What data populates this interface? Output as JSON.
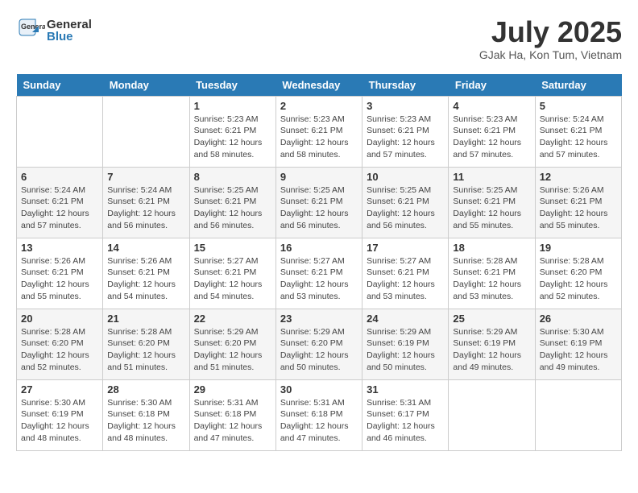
{
  "header": {
    "logo_line1": "General",
    "logo_line2": "Blue",
    "month_title": "July 2025",
    "location": "GJak Ha, Kon Tum, Vietnam"
  },
  "days_of_week": [
    "Sunday",
    "Monday",
    "Tuesday",
    "Wednesday",
    "Thursday",
    "Friday",
    "Saturday"
  ],
  "weeks": [
    [
      {
        "day": "",
        "info": ""
      },
      {
        "day": "",
        "info": ""
      },
      {
        "day": "1",
        "info": "Sunrise: 5:23 AM\nSunset: 6:21 PM\nDaylight: 12 hours and 58 minutes."
      },
      {
        "day": "2",
        "info": "Sunrise: 5:23 AM\nSunset: 6:21 PM\nDaylight: 12 hours and 58 minutes."
      },
      {
        "day": "3",
        "info": "Sunrise: 5:23 AM\nSunset: 6:21 PM\nDaylight: 12 hours and 57 minutes."
      },
      {
        "day": "4",
        "info": "Sunrise: 5:23 AM\nSunset: 6:21 PM\nDaylight: 12 hours and 57 minutes."
      },
      {
        "day": "5",
        "info": "Sunrise: 5:24 AM\nSunset: 6:21 PM\nDaylight: 12 hours and 57 minutes."
      }
    ],
    [
      {
        "day": "6",
        "info": "Sunrise: 5:24 AM\nSunset: 6:21 PM\nDaylight: 12 hours and 57 minutes."
      },
      {
        "day": "7",
        "info": "Sunrise: 5:24 AM\nSunset: 6:21 PM\nDaylight: 12 hours and 56 minutes."
      },
      {
        "day": "8",
        "info": "Sunrise: 5:25 AM\nSunset: 6:21 PM\nDaylight: 12 hours and 56 minutes."
      },
      {
        "day": "9",
        "info": "Sunrise: 5:25 AM\nSunset: 6:21 PM\nDaylight: 12 hours and 56 minutes."
      },
      {
        "day": "10",
        "info": "Sunrise: 5:25 AM\nSunset: 6:21 PM\nDaylight: 12 hours and 56 minutes."
      },
      {
        "day": "11",
        "info": "Sunrise: 5:25 AM\nSunset: 6:21 PM\nDaylight: 12 hours and 55 minutes."
      },
      {
        "day": "12",
        "info": "Sunrise: 5:26 AM\nSunset: 6:21 PM\nDaylight: 12 hours and 55 minutes."
      }
    ],
    [
      {
        "day": "13",
        "info": "Sunrise: 5:26 AM\nSunset: 6:21 PM\nDaylight: 12 hours and 55 minutes."
      },
      {
        "day": "14",
        "info": "Sunrise: 5:26 AM\nSunset: 6:21 PM\nDaylight: 12 hours and 54 minutes."
      },
      {
        "day": "15",
        "info": "Sunrise: 5:27 AM\nSunset: 6:21 PM\nDaylight: 12 hours and 54 minutes."
      },
      {
        "day": "16",
        "info": "Sunrise: 5:27 AM\nSunset: 6:21 PM\nDaylight: 12 hours and 53 minutes."
      },
      {
        "day": "17",
        "info": "Sunrise: 5:27 AM\nSunset: 6:21 PM\nDaylight: 12 hours and 53 minutes."
      },
      {
        "day": "18",
        "info": "Sunrise: 5:28 AM\nSunset: 6:21 PM\nDaylight: 12 hours and 53 minutes."
      },
      {
        "day": "19",
        "info": "Sunrise: 5:28 AM\nSunset: 6:20 PM\nDaylight: 12 hours and 52 minutes."
      }
    ],
    [
      {
        "day": "20",
        "info": "Sunrise: 5:28 AM\nSunset: 6:20 PM\nDaylight: 12 hours and 52 minutes."
      },
      {
        "day": "21",
        "info": "Sunrise: 5:28 AM\nSunset: 6:20 PM\nDaylight: 12 hours and 51 minutes."
      },
      {
        "day": "22",
        "info": "Sunrise: 5:29 AM\nSunset: 6:20 PM\nDaylight: 12 hours and 51 minutes."
      },
      {
        "day": "23",
        "info": "Sunrise: 5:29 AM\nSunset: 6:20 PM\nDaylight: 12 hours and 50 minutes."
      },
      {
        "day": "24",
        "info": "Sunrise: 5:29 AM\nSunset: 6:19 PM\nDaylight: 12 hours and 50 minutes."
      },
      {
        "day": "25",
        "info": "Sunrise: 5:29 AM\nSunset: 6:19 PM\nDaylight: 12 hours and 49 minutes."
      },
      {
        "day": "26",
        "info": "Sunrise: 5:30 AM\nSunset: 6:19 PM\nDaylight: 12 hours and 49 minutes."
      }
    ],
    [
      {
        "day": "27",
        "info": "Sunrise: 5:30 AM\nSunset: 6:19 PM\nDaylight: 12 hours and 48 minutes."
      },
      {
        "day": "28",
        "info": "Sunrise: 5:30 AM\nSunset: 6:18 PM\nDaylight: 12 hours and 48 minutes."
      },
      {
        "day": "29",
        "info": "Sunrise: 5:31 AM\nSunset: 6:18 PM\nDaylight: 12 hours and 47 minutes."
      },
      {
        "day": "30",
        "info": "Sunrise: 5:31 AM\nSunset: 6:18 PM\nDaylight: 12 hours and 47 minutes."
      },
      {
        "day": "31",
        "info": "Sunrise: 5:31 AM\nSunset: 6:17 PM\nDaylight: 12 hours and 46 minutes."
      },
      {
        "day": "",
        "info": ""
      },
      {
        "day": "",
        "info": ""
      }
    ]
  ]
}
